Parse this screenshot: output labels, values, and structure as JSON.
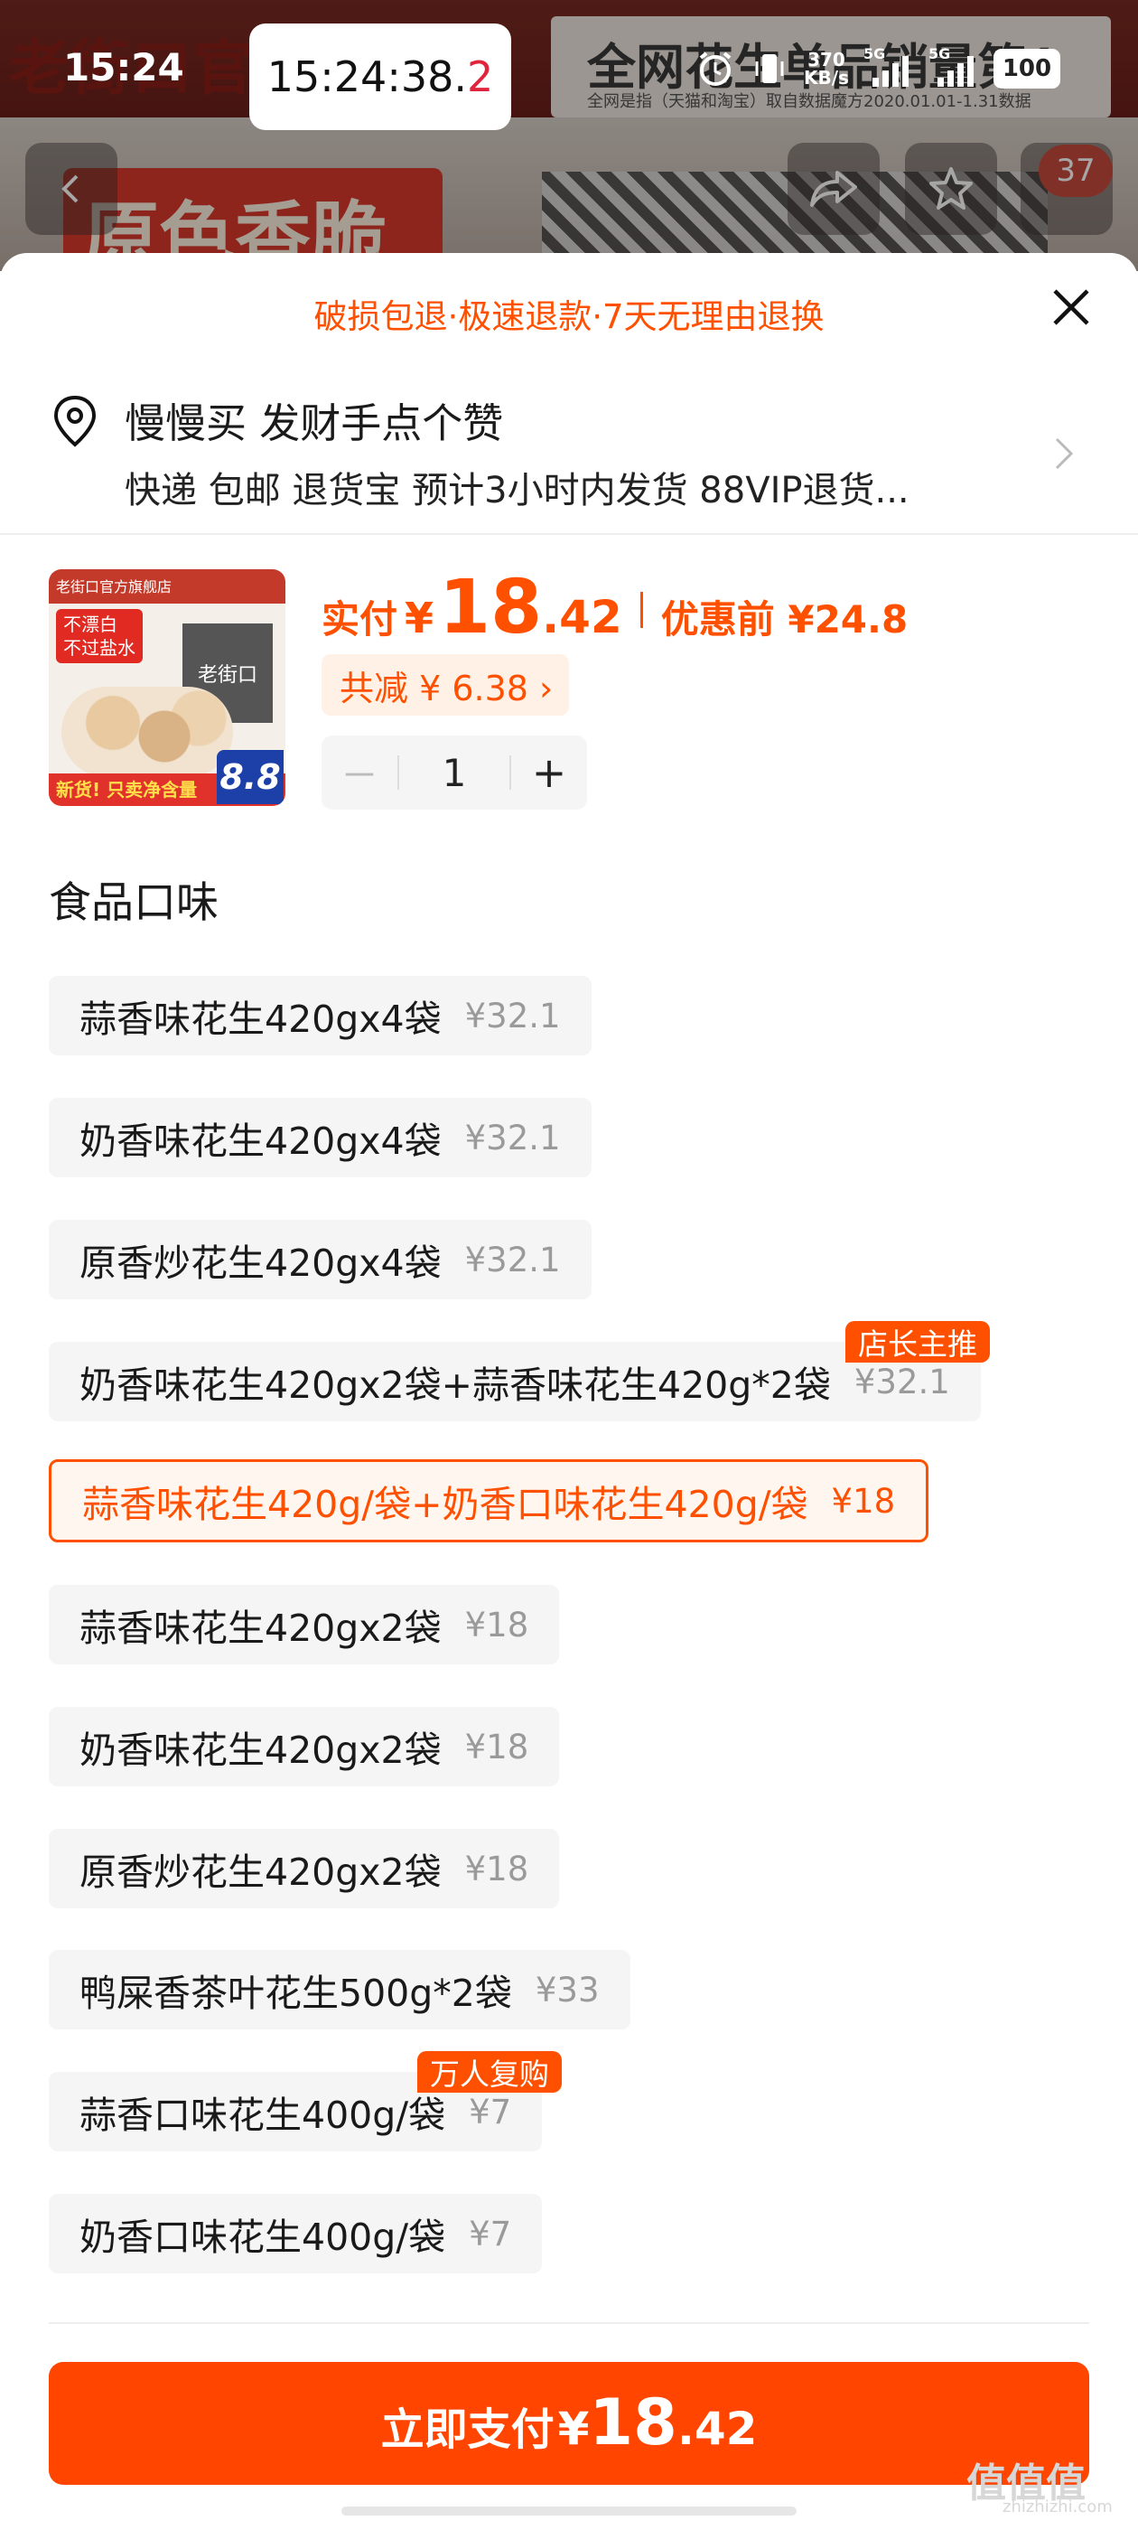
{
  "status_bar": {
    "time": "15:24",
    "clock_main": "15:24:38.",
    "clock_tenth": "2",
    "net_speed_value": "370",
    "net_speed_unit": "KB/s",
    "signal1": "5G",
    "signal2": "5G",
    "battery": "100"
  },
  "background_page": {
    "brand_text": "老街口官",
    "banner_title": "全网花生单品销量第1",
    "banner_sub": "全网是指（天猫和淘宝）取自数据魔方2020.01.01-1.31数据",
    "label_text": "原色香脆",
    "cart_count": "37"
  },
  "sheet": {
    "return_policy": "破损包退·极速退款·7天无理由退换",
    "address": {
      "name": "慢慢买 发财手点个赞",
      "info": "快递 包邮 退货宝 预计3小时内发货 88VIP退货..."
    },
    "product": {
      "thumb_shop": "老街口官方旗舰店",
      "thumb_brand": "老街口",
      "thumb_badge": "不漂白\n不过盐水",
      "thumb_bottom": "新货! 只卖净含量",
      "thumb_price": "8.8",
      "paid_label": "实付",
      "currency": "¥",
      "paid_int": "18",
      "paid_dec": ".42",
      "before_label": "优惠前 ¥24.8",
      "discount": "共减 ¥ 6.38 ›",
      "quantity": "1",
      "minus": "－",
      "plus": "+"
    },
    "flavor_title": "食品口味",
    "options": [
      {
        "label": "蒜香味花生420gx4袋",
        "price": "¥32.1"
      },
      {
        "label": "奶香味花生420gx4袋",
        "price": "¥32.1"
      },
      {
        "label": "原香炒花生420gx4袋",
        "price": "¥32.1"
      },
      {
        "label": "奶香味花生420gx2袋+蒜香味花生420g*2袋",
        "price": "¥32.1",
        "tag": "店长主推"
      },
      {
        "label": "蒜香味花生420g/袋+奶香口味花生420g/袋",
        "price": "¥18",
        "selected": true
      },
      {
        "label": "蒜香味花生420gx2袋",
        "price": "¥18"
      },
      {
        "label": "奶香味花生420gx2袋",
        "price": "¥18"
      },
      {
        "label": "原香炒花生420gx2袋",
        "price": "¥18"
      },
      {
        "label": "鸭屎香茶叶花生500g*2袋",
        "price": "¥33"
      },
      {
        "label": "蒜香口味花生400g/袋",
        "price": "¥7",
        "tag": "万人复购"
      },
      {
        "label": "奶香口味花生400g/袋",
        "price": "¥7"
      }
    ],
    "pay_button": {
      "label": "立即支付",
      "currency": "¥",
      "int": "18",
      "dec": ".42"
    }
  },
  "watermark": {
    "text": "值值值",
    "url": "zhizhizhi.com"
  },
  "colors": {
    "accent": "#ff5000",
    "pay_button": "#ff4500",
    "option_bg": "#f5f5f5"
  }
}
